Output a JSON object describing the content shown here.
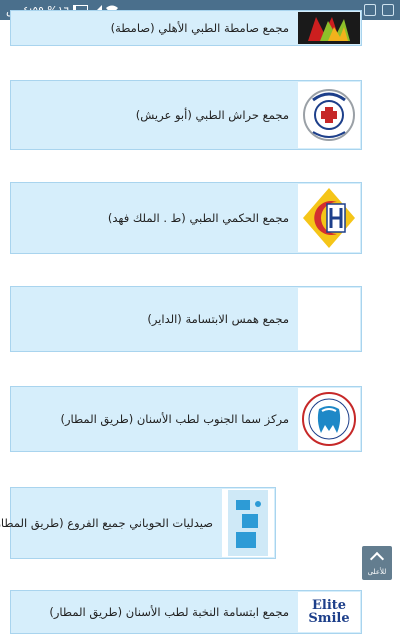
{
  "status_bar": {
    "time": "٤:٥٩ ص",
    "battery_percent": "%١٦",
    "battery_level": 0.16
  },
  "places": [
    {
      "name": "مجمع صامطة الطبي الأهلي (صامطة)",
      "logo_icon": "samtah-logo"
    },
    {
      "name": "مجمع حراش الطبي (أبو عريش)",
      "logo_icon": "harash-logo"
    },
    {
      "name": "مجمع الحكمي الطبي (ط . الملك فهد)",
      "logo_icon": "hakami-logo"
    },
    {
      "name": "مجمع همس الابتسامة (الداير)",
      "logo_icon": "red-crescent-icon"
    },
    {
      "name": "مركز سما الجنوب لطب الأسنان (طريق المطار)",
      "logo_icon": "tooth-logo"
    },
    {
      "name": "صيدليات الحوباني جميع الفروع (طريق المطار)",
      "logo_icon": "pharmacy-logo"
    },
    {
      "name": "مجمع ابتسامة النخبة لطب الأسنان (طريق المطار)",
      "logo_icon": "elite-smile-logo"
    }
  ],
  "logo_text": {
    "elite": "Elite",
    "smile": "Smile"
  },
  "scroll_top": {
    "label": "للأعلى"
  }
}
